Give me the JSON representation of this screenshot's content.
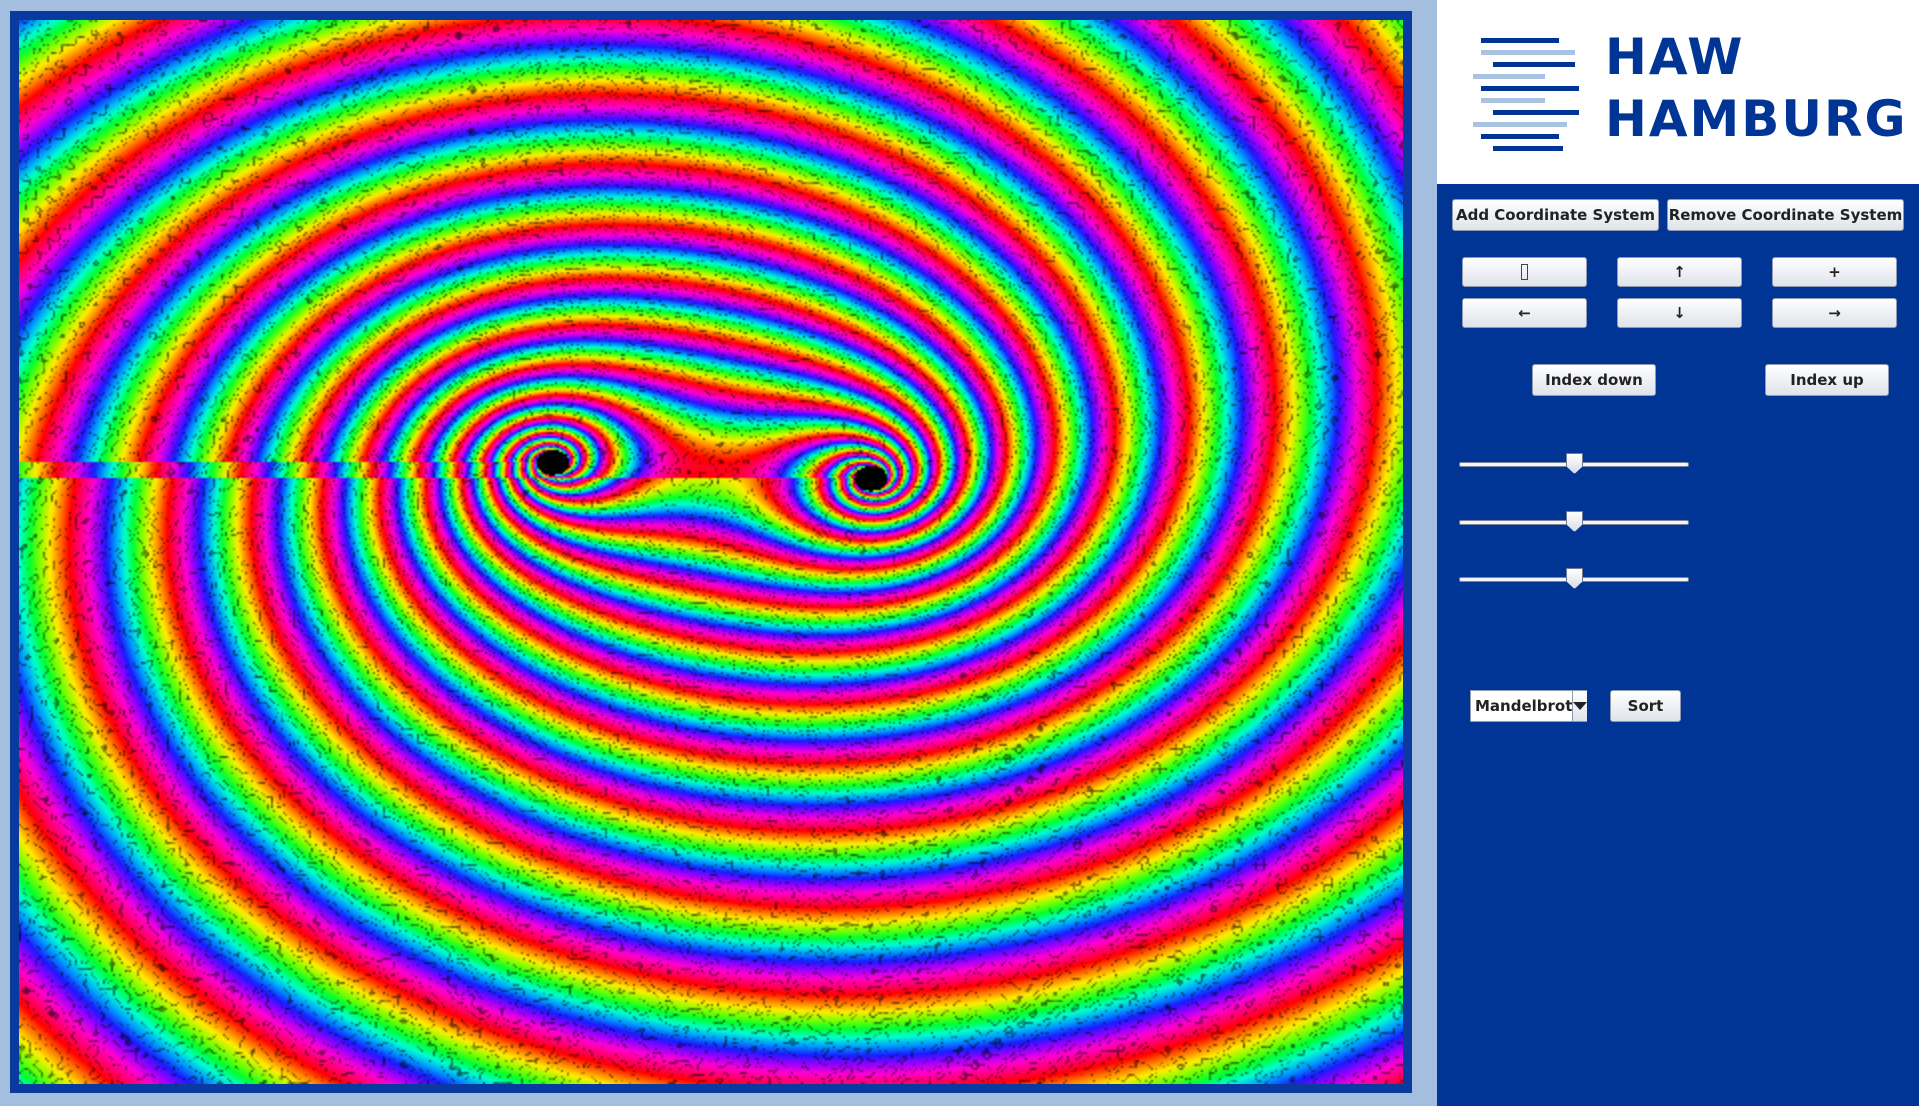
{
  "fractal_view": {
    "fractal_type": "Mandelbrot",
    "palette": [
      "#ff0000",
      "#ff7a00",
      "#ffee00",
      "#7dff00",
      "#00ff30",
      "#00ffd0",
      "#0099ff",
      "#1a1aff",
      "#9a00ff",
      "#ff00d2",
      "#ff0070"
    ]
  },
  "logo": {
    "line1": "HAW",
    "line2": "HAMBURG"
  },
  "toolbar": {
    "add_coordinate_system": "Add Coordinate System",
    "remove_coordinate_system": "Remove Coordinate System",
    "zoom_out": "",
    "move_up": "↑",
    "zoom_in": "+",
    "move_left": "←",
    "move_down": "↓",
    "move_right": "→",
    "index_down": "Index down",
    "index_up": "Index up",
    "sort": "Sort"
  },
  "sliders": [
    {
      "value": 0.5
    },
    {
      "value": 0.5
    },
    {
      "value": 0.5
    }
  ],
  "fractal_select": {
    "selected": "Mandelbrot"
  },
  "colors": {
    "brand_blue": "#003596",
    "frame_light_blue": "#a3bedf",
    "logo_line_light": "#a8c3e2"
  }
}
